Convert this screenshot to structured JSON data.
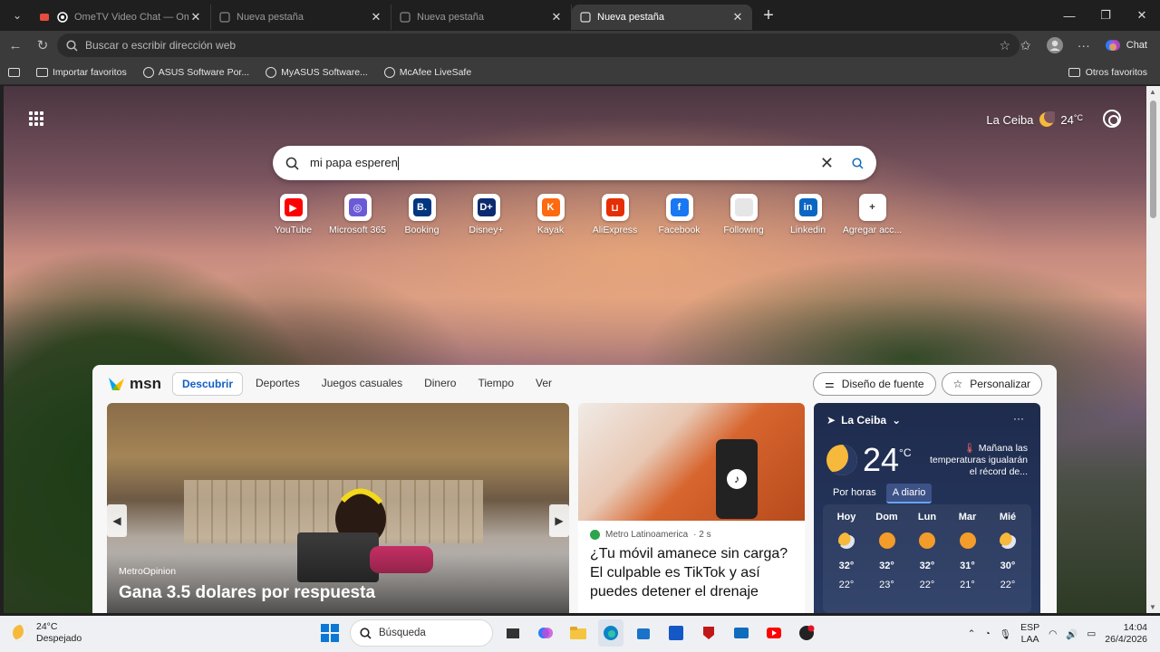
{
  "tabs": [
    {
      "label": "OmeTV Video Chat — Omegle",
      "active": false
    },
    {
      "label": "Nueva pestaña",
      "active": false
    },
    {
      "label": "Nueva pestaña",
      "active": false
    },
    {
      "label": "Nueva pestaña",
      "active": true
    }
  ],
  "address_bar": {
    "placeholder": "Buscar o escribir dirección web"
  },
  "toolbar": {
    "chat_label": "Chat"
  },
  "favorites": [
    {
      "label": "Importar favoritos",
      "icon": "folder-icon"
    },
    {
      "label": "ASUS Software Por...",
      "icon": "globe-icon"
    },
    {
      "label": "MyASUS Software...",
      "icon": "globe-icon"
    },
    {
      "label": "McAfee LiveSafe",
      "icon": "globe-icon"
    }
  ],
  "favorites_other": "Otros favoritos",
  "weather_header": {
    "location": "La Ceiba",
    "temp": "24",
    "unit": "°C"
  },
  "search": {
    "value": "mi papa esperen"
  },
  "quick_links": [
    {
      "label": "YouTube",
      "color": "#ff0000",
      "glyph": "▶"
    },
    {
      "label": "Microsoft 365",
      "color": "#6b5bd6",
      "glyph": "◎"
    },
    {
      "label": "Booking",
      "color": "#003580",
      "glyph": "B."
    },
    {
      "label": "Disney+",
      "color": "#0b2a6f",
      "glyph": "D+"
    },
    {
      "label": "Kayak",
      "color": "#ff690f",
      "glyph": "K"
    },
    {
      "label": "AliExpress",
      "color": "#e62e04",
      "glyph": "⊔"
    },
    {
      "label": "Facebook",
      "color": "#1877f2",
      "glyph": "f"
    },
    {
      "label": "Following",
      "color": "#e6e6e6",
      "glyph": ""
    },
    {
      "label": "Linkedin",
      "color": "#0a66c2",
      "glyph": "in"
    },
    {
      "label": "Agregar acc...",
      "color": "#ffffff",
      "glyph": "+"
    }
  ],
  "msn": {
    "logo": "msn",
    "nav": [
      "Descubrir",
      "Deportes",
      "Juegos casuales",
      "Dinero",
      "Tiempo",
      "Ver"
    ],
    "active_nav": "Descubrir",
    "actions": [
      "Diseño de fuente",
      "Personalizar"
    ]
  },
  "main_card": {
    "source": "MetroOpinion",
    "title": "Gana 3.5 dolares por respuesta"
  },
  "news_card": {
    "source": "Metro Latinoamerica",
    "age": "· 2 s",
    "headline": "¿Tu móvil amanece sin carga? El culpable es TikTok y así puedes detener el drenaje"
  },
  "weather_card": {
    "location": "La Ceiba",
    "temp": "24",
    "unit": "°C",
    "alert": "Mañana las temperaturas igualarán el récord de...",
    "tabs": [
      "Por horas",
      "A diario"
    ],
    "days": [
      {
        "day": "Hoy",
        "hi": "32°",
        "lo": "22°",
        "icon": "partly-cloudy-icon"
      },
      {
        "day": "Dom",
        "hi": "32°",
        "lo": "23°",
        "icon": "sun-icon"
      },
      {
        "day": "Lun",
        "hi": "32°",
        "lo": "22°",
        "icon": "sun-icon"
      },
      {
        "day": "Mar",
        "hi": "31°",
        "lo": "21°",
        "icon": "sun-icon"
      },
      {
        "day": "Mié",
        "hi": "30°",
        "lo": "22°",
        "icon": "partly-cloudy-icon"
      }
    ]
  },
  "taskbar": {
    "weather_temp": "24°C",
    "weather_desc": "Despejado",
    "search_label": "Búsqueda",
    "lang": "ESP",
    "layout": "LAA",
    "time": "14:04",
    "date": "26/4/2026"
  }
}
